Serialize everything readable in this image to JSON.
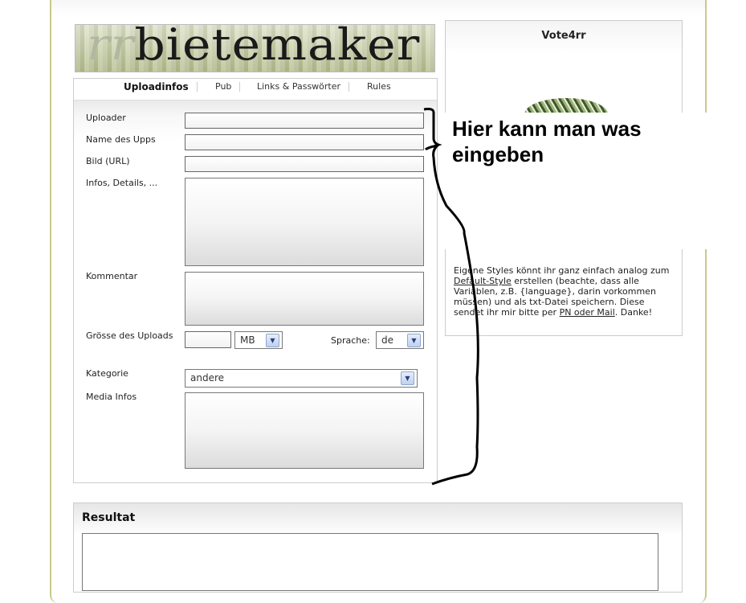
{
  "logo": {
    "text_rr": "rr",
    "text_main": "bietemaker"
  },
  "tabs": [
    "Uploadinfos",
    "Pub",
    "Links & Passwörter",
    "Rules"
  ],
  "form": {
    "uploader_label": "Uploader",
    "name_label": "Name des Upps",
    "bild_label": "Bild (URL)",
    "infos_label": "Infos, Details, ...",
    "kommentar_label": "Kommentar",
    "groesse_label": "Grösse des Uploads",
    "unit_value": "MB",
    "sprache_label": "Sprache:",
    "sprache_value": "de",
    "kategorie_label": "Kategorie",
    "kategorie_value": "andere",
    "media_label": "Media Infos"
  },
  "sidebar": {
    "vote_title": "Vote4rr",
    "styles_p1": "Eigene Styles könnt ihr ganz einfach analog zum ",
    "styles_link1": "Default-Style",
    "styles_p2": " erstellen (beachte, dass alle Variablen, z.B. {language}, darin vorkommen müssen) und als txt-Datei speichern. Diese sendet ihr mir bitte per ",
    "styles_link2": "PN oder Mail",
    "styles_p3": ". Danke!"
  },
  "annotation": {
    "line1": "Hier kann man was",
    "line2": "eingeben"
  },
  "result": {
    "title": "Resultat"
  },
  "colors": {
    "frame_border": "#c8ca8a",
    "select_arrow": "#bfd0ef"
  },
  "icons": {
    "dropdown": "chevron-down-icon"
  }
}
